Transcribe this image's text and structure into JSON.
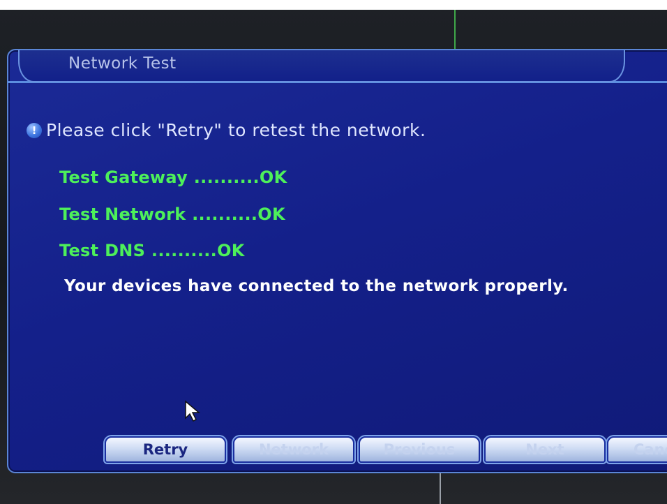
{
  "dialog": {
    "title": "Network Test",
    "info_icon": "info-icon",
    "info_text": "Please click \"Retry\" to retest the network.",
    "tests": [
      {
        "label": "Test Gateway ..........OK"
      },
      {
        "label": "Test Network ..........OK"
      },
      {
        "label": "Test DNS ..........OK"
      }
    ],
    "result": "Your devices have connected to the network properly."
  },
  "buttons": {
    "retry": "Retry",
    "network": "Network",
    "previous": "Previous",
    "next": "Next",
    "cancel": "Canc"
  },
  "colors": {
    "panel": "#14208a",
    "border": "#5b86d6",
    "ok_text": "#4df05a",
    "button_text": "#1a2680"
  }
}
